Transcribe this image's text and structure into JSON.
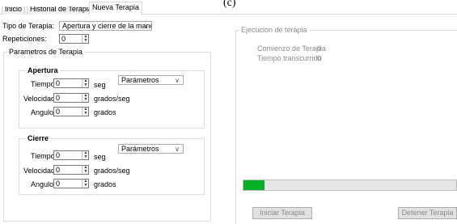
{
  "figure_label": "(c)",
  "tabs": [
    "Inicio",
    "Historial de Terapias",
    "Nueva Terapia"
  ],
  "tipo_terapia": {
    "label": "Tipo de Terapia:",
    "value": "Apertura y cierre de la mano"
  },
  "repeticiones": {
    "label": "Repeticiones:",
    "value": "0"
  },
  "parametros": {
    "title": "Parametros de Terapia",
    "apertura": {
      "title": "Apertura",
      "combo": "Parámetros",
      "tiempo": {
        "label": "Tiempo",
        "value": "0",
        "unit": "seg"
      },
      "velocidad": {
        "label": "Velocidad",
        "value": "0",
        "unit": "grados/seg"
      },
      "angulo": {
        "label": "Angulo",
        "value": "0",
        "unit": "grados"
      }
    },
    "cierre": {
      "title": "Cierre",
      "combo": "Parámetros",
      "tiempo": {
        "label": "Tiempo",
        "value": "0",
        "unit": "seg"
      },
      "velocidad": {
        "label": "Velocidad",
        "value": "0",
        "unit": "grados/seg"
      },
      "angulo": {
        "label": "Angulo",
        "value": "0",
        "unit": "grados"
      }
    }
  },
  "ejecucion": {
    "title": "Ejecucion de terapia",
    "comienzo": {
      "label": "Comienzo de Terapia",
      "value": "0"
    },
    "transcurrido": {
      "label": "Tiempo transcurrido",
      "value": "0"
    },
    "progress_fraction": 0.1,
    "progress_color": "#06b025",
    "iniciar_label": "Iniciar Terapia",
    "detener_label": "Detener Terapia"
  },
  "icons": {
    "combo_arrow": "chevron-down-icon",
    "spin_up": "spin-up-icon",
    "spin_down": "spin-down-icon"
  }
}
